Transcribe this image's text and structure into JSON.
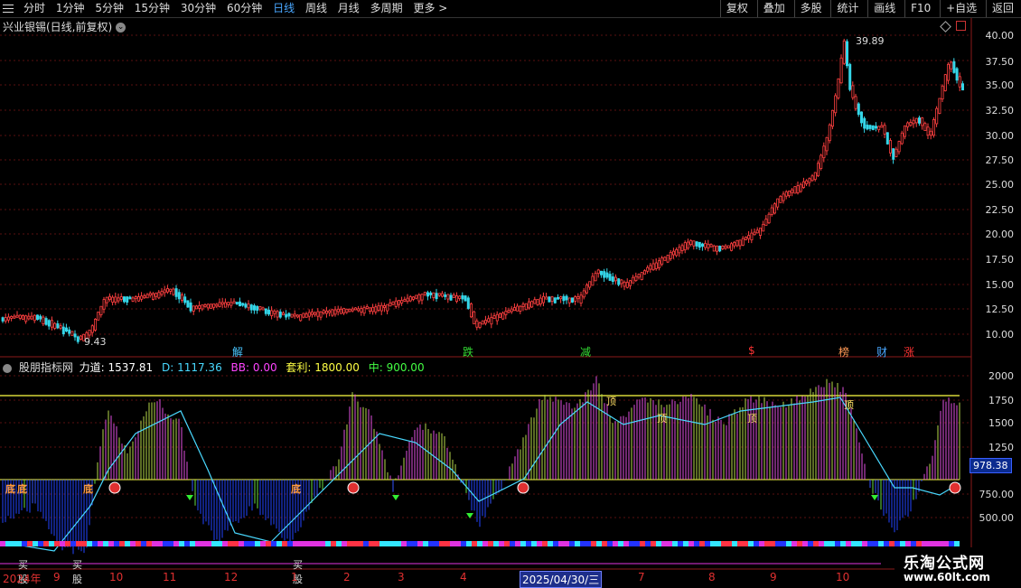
{
  "toolbar": {
    "periods": [
      "分时",
      "1分钟",
      "5分钟",
      "15分钟",
      "30分钟",
      "60分钟",
      "日线",
      "周线",
      "月线",
      "多周期",
      "更多 >"
    ],
    "active_period": "日线",
    "right_buttons": [
      "复权",
      "叠加",
      "多股",
      "统计",
      "画线",
      "F10",
      "+自选",
      "返回"
    ]
  },
  "stock": {
    "title": "兴业银锡(日线,前复权)"
  },
  "price_axis": [
    "40.00",
    "37.50",
    "35.00",
    "32.50",
    "30.00",
    "27.50",
    "25.00",
    "22.50",
    "20.00",
    "17.50",
    "15.00",
    "12.50",
    "10.00"
  ],
  "price_labels": {
    "high": "39.89",
    "low": "9.43"
  },
  "event_markers": [
    {
      "text": "解",
      "color": "#49c6ff"
    },
    {
      "text": "跌",
      "color": "#33dd33"
    },
    {
      "text": "减",
      "color": "#33dd33"
    },
    {
      "text": "$",
      "color": "#ff3333"
    },
    {
      "text": "榜",
      "color": "#ff9955"
    },
    {
      "text": "财",
      "color": "#49a7ff"
    },
    {
      "text": "涨",
      "color": "#ff3333"
    }
  ],
  "indicator": {
    "name": "股朋指标网",
    "items": [
      {
        "label": "力道: 1537.81",
        "color": "#ffffff"
      },
      {
        "label": "D: 1117.36",
        "color": "#49d9ff"
      },
      {
        "label": "BB: 0.00",
        "color": "#ff44ff"
      },
      {
        "label": "套利: 1800.00",
        "color": "#ffff44"
      },
      {
        "label": "中: 900.00",
        "color": "#44ff44"
      }
    ],
    "axis": [
      "2000",
      "1750",
      "1500",
      "1250",
      "750.00",
      "500.00"
    ],
    "current_value": "978.38",
    "ding_label": "顶",
    "di_label": "底",
    "buy_label": "买股"
  },
  "dates": [
    {
      "text": "2024年"
    },
    {
      "text": "9"
    },
    {
      "text": "10"
    },
    {
      "text": "11"
    },
    {
      "text": "12"
    },
    {
      "text": "1"
    },
    {
      "text": "2"
    },
    {
      "text": "3"
    },
    {
      "text": "4"
    },
    {
      "text": "2025/04/30/三",
      "selected": true
    },
    {
      "text": "7"
    },
    {
      "text": "8"
    },
    {
      "text": "9"
    },
    {
      "text": "10"
    }
  ],
  "watermark": {
    "line1": "乐淘公式网",
    "line2": "www.60lt.com"
  }
}
